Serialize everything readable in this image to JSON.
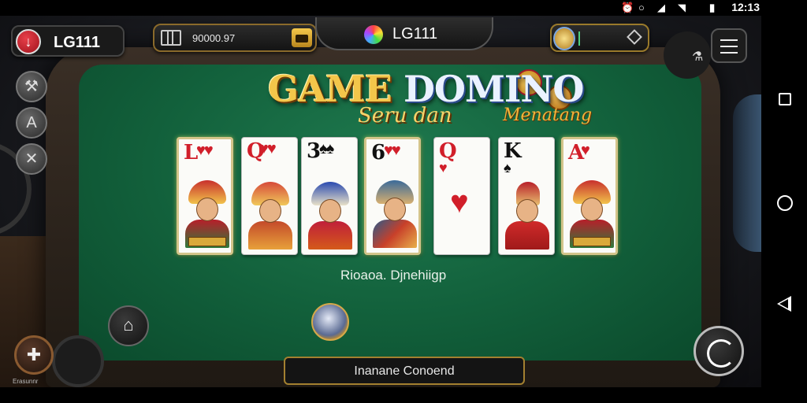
{
  "status_bar": {
    "clock": "12:13",
    "icons": [
      "alarm-icon",
      "circle-icon",
      "mute-icon",
      "wifi-icon",
      "battery-icon"
    ]
  },
  "top_bar": {
    "brand_left": "LG111",
    "balance": "90000.97",
    "center_brand": "LG111"
  },
  "title": {
    "part1": "GAME",
    "part2": "DOMINO",
    "sub_left": "Seru dan",
    "sub_right": "Menatang"
  },
  "cards": [
    {
      "rank": "L",
      "pips": "♥♥",
      "color": "#d11f2a",
      "style": "face"
    },
    {
      "rank": "Q",
      "pips": "♥♥",
      "color": "#d11f2a",
      "style": "face"
    },
    {
      "rank": "3",
      "pips": "♠♠",
      "color": "#111111",
      "style": "face"
    },
    {
      "rank": "6",
      "pips": "♥♥",
      "color": "#111111",
      "style": "face"
    },
    {
      "rank": "Q",
      "pips": "",
      "color": "#d11f2a",
      "style": "plain"
    },
    {
      "rank": "K",
      "pips": "",
      "color": "#111111",
      "style": "face"
    },
    {
      "rank": "A",
      "pips": "♥",
      "color": "#d11f2a",
      "style": "face"
    }
  ],
  "card_labels": {
    "card0": "ZIKOP",
    "card6": "ZIKOP"
  },
  "subtitle": "Rioaoa. Djnehiigp",
  "action_label": "Inanane Conoend",
  "bottom_left_text": "Erasunnr",
  "colors": {
    "felt": "#12603b",
    "gold": "#f3c64a",
    "card_red": "#d11f2a"
  }
}
